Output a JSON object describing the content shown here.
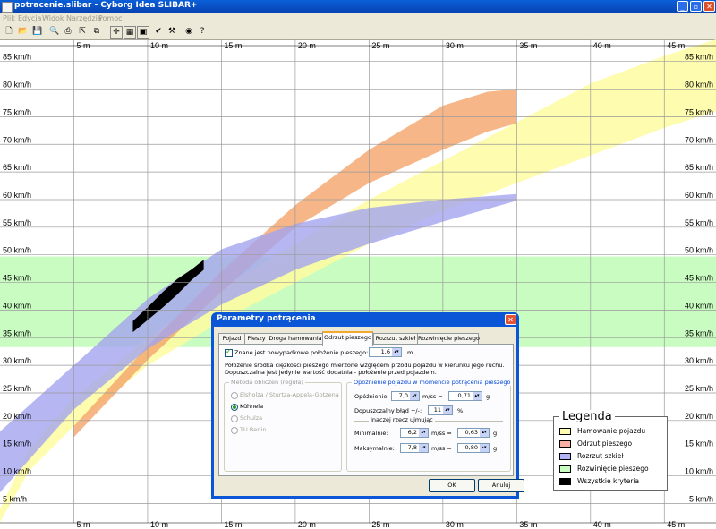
{
  "window": {
    "title": "potracenie.slibar - Cyborg Idea SLIBAR+",
    "minimize": "_",
    "maximize": "▫",
    "close": "✕"
  },
  "menu": [
    "Plik",
    "Edycja",
    "Widok",
    "Narzędzia",
    "Pomoc"
  ],
  "toolbar_icons": [
    "new-file-icon",
    "open-folder-icon",
    "save-icon",
    "print-preview-icon",
    "print-icon",
    "export-icon",
    "copy-icon",
    "crosshair-icon",
    "grid-icon",
    "window-icon",
    "check-edit-icon",
    "tools-icon",
    "globe-icon",
    "help-icon"
  ],
  "chart_data": {
    "type": "area",
    "x_ticks": [
      "5 m",
      "10 m",
      "15 m",
      "20 m",
      "25 m",
      "30 m",
      "35 m",
      "40 m",
      "45 m"
    ],
    "x_tick_values": [
      5,
      10,
      15,
      20,
      25,
      30,
      35,
      40,
      45
    ],
    "y_ticks": [
      "5 km/h",
      "10 km/h",
      "15 km/h",
      "20 km/h",
      "25 km/h",
      "30 km/h",
      "35 km/h",
      "40 km/h",
      "45 km/h",
      "50 km/h",
      "55 km/h",
      "60 km/h",
      "65 km/h",
      "70 km/h",
      "75 km/h",
      "80 km/h",
      "85 km/h"
    ],
    "y_tick_values": [
      5,
      10,
      15,
      20,
      25,
      30,
      35,
      40,
      45,
      50,
      55,
      60,
      65,
      70,
      75,
      80,
      85
    ],
    "xlim": [
      0,
      48.5
    ],
    "ylim": [
      1.5,
      89
    ],
    "grid": true,
    "legend_position": "bottom-right",
    "bands": [
      {
        "type": "hband",
        "y1": 33.3,
        "y2": 49.7,
        "color": "#c8fcc0"
      },
      {
        "lower": [
          [
            0,
            1.6
          ],
          [
            2,
            11
          ],
          [
            5,
            19
          ],
          [
            10,
            30
          ],
          [
            15,
            38
          ],
          [
            20,
            45
          ],
          [
            25,
            52
          ],
          [
            30,
            58
          ],
          [
            35,
            63
          ],
          [
            40,
            68
          ],
          [
            45,
            73
          ],
          [
            48.5,
            76
          ]
        ],
        "upper": [
          [
            0,
            4
          ],
          [
            2,
            15
          ],
          [
            5,
            24
          ],
          [
            10,
            35
          ],
          [
            15,
            44
          ],
          [
            20,
            52
          ],
          [
            25,
            60
          ],
          [
            30,
            67
          ],
          [
            35,
            74
          ],
          [
            40,
            81
          ],
          [
            45,
            86
          ],
          [
            48.5,
            89
          ]
        ],
        "color": "#fefca0",
        "alpha": 0.85
      },
      {
        "lower": [
          [
            5,
            17
          ],
          [
            10,
            31
          ],
          [
            15,
            43.3
          ],
          [
            20,
            55
          ],
          [
            25,
            63
          ],
          [
            30,
            69
          ],
          [
            33,
            72.3
          ],
          [
            35,
            73.8
          ]
        ],
        "upper": [
          [
            5,
            19
          ],
          [
            10,
            33.5
          ],
          [
            15,
            47
          ],
          [
            20,
            59
          ],
          [
            25,
            69
          ],
          [
            30,
            77
          ],
          [
            33,
            79.5
          ],
          [
            35,
            80
          ]
        ],
        "color": "#f4a46a",
        "alpha": 0.8
      },
      {
        "lower": [
          [
            0,
            7
          ],
          [
            5,
            22
          ],
          [
            10,
            33
          ],
          [
            15,
            41
          ],
          [
            20,
            47.3
          ],
          [
            25,
            52
          ],
          [
            30,
            56
          ],
          [
            35,
            59.8
          ]
        ],
        "upper": [
          [
            0,
            18
          ],
          [
            5,
            30
          ],
          [
            10,
            42
          ],
          [
            15,
            51
          ],
          [
            20,
            55.6
          ],
          [
            25,
            58.5
          ],
          [
            30,
            60
          ],
          [
            35,
            61
          ]
        ],
        "color": "#a4a4f0",
        "alpha": 0.8
      },
      {
        "lower": [
          [
            9,
            36
          ],
          [
            10,
            38.2
          ],
          [
            11,
            40.4
          ],
          [
            12,
            42.8
          ],
          [
            13,
            45.5
          ],
          [
            13.8,
            47.3
          ]
        ],
        "upper": [
          [
            9,
            38
          ],
          [
            10,
            40.5
          ],
          [
            11,
            43.2
          ],
          [
            12,
            45.6
          ],
          [
            13,
            47.4
          ],
          [
            13.8,
            49.1
          ]
        ],
        "color": "#000000",
        "alpha": 1
      }
    ]
  },
  "legend": {
    "title": "Legenda",
    "items": [
      {
        "label": "Hamowanie pojazdu",
        "color": "#fefcb0"
      },
      {
        "label": "Odrzut pieszego",
        "color": "#f7b0a6"
      },
      {
        "label": "Rozrzut szkieł",
        "color": "#b2b2f4"
      },
      {
        "label": "Rozwinięcie pieszego",
        "color": "#c8fcc0"
      },
      {
        "label": "Wszystkie kryteria",
        "color": "#000000"
      }
    ]
  },
  "dialog": {
    "title": "Parametry potrącenia",
    "close": "✕",
    "tabs": [
      "Pojazd",
      "Pieszy",
      "Droga hamowania",
      "Odrzut pieszego",
      "Rozrzut szkieł",
      "Rozwinięcie pieszego"
    ],
    "active_tab": "Odrzut pieszego",
    "known_position_label": "Znane jest powypadkowe położenie pieszego:",
    "known_position_value": "1,6",
    "known_position_unit": "m",
    "note_line1": "Położenie środka ciężkości pieszego mierzone względem przodu pojazdu w kierunku jego ruchu.",
    "note_line2": "Dopuszczalna jest jedynie wartość dodatnia - położenie przed pojazdem.",
    "method_group": "Metoda obliczeń (reguła)",
    "methods": [
      "Elsholza / Sturtza-Appela-Gotzena",
      "Kühnela",
      "Schulza",
      "TU Berlin"
    ],
    "selected_method": "Kühnela",
    "delay_group": "Opóźnienie pojazdu w momencie potrącenia pieszego",
    "delay_label": "Opóźnienie:",
    "delay_value": "7,0",
    "delay_unit": "m/ss =",
    "delay_g": "0,71",
    "g": "g",
    "error_label": "Dopuszczalny błąd +/-:",
    "error_value": "11",
    "error_unit": "%",
    "alt_label": "Inaczej rzecz ujmując",
    "min_label": "Minimalnie:",
    "min_value": "6,2",
    "min_g": "0,63",
    "max_label": "Maksymalnie:",
    "max_value": "7,8",
    "max_g": "0,80",
    "ok": "OK",
    "cancel": "Anuluj"
  }
}
